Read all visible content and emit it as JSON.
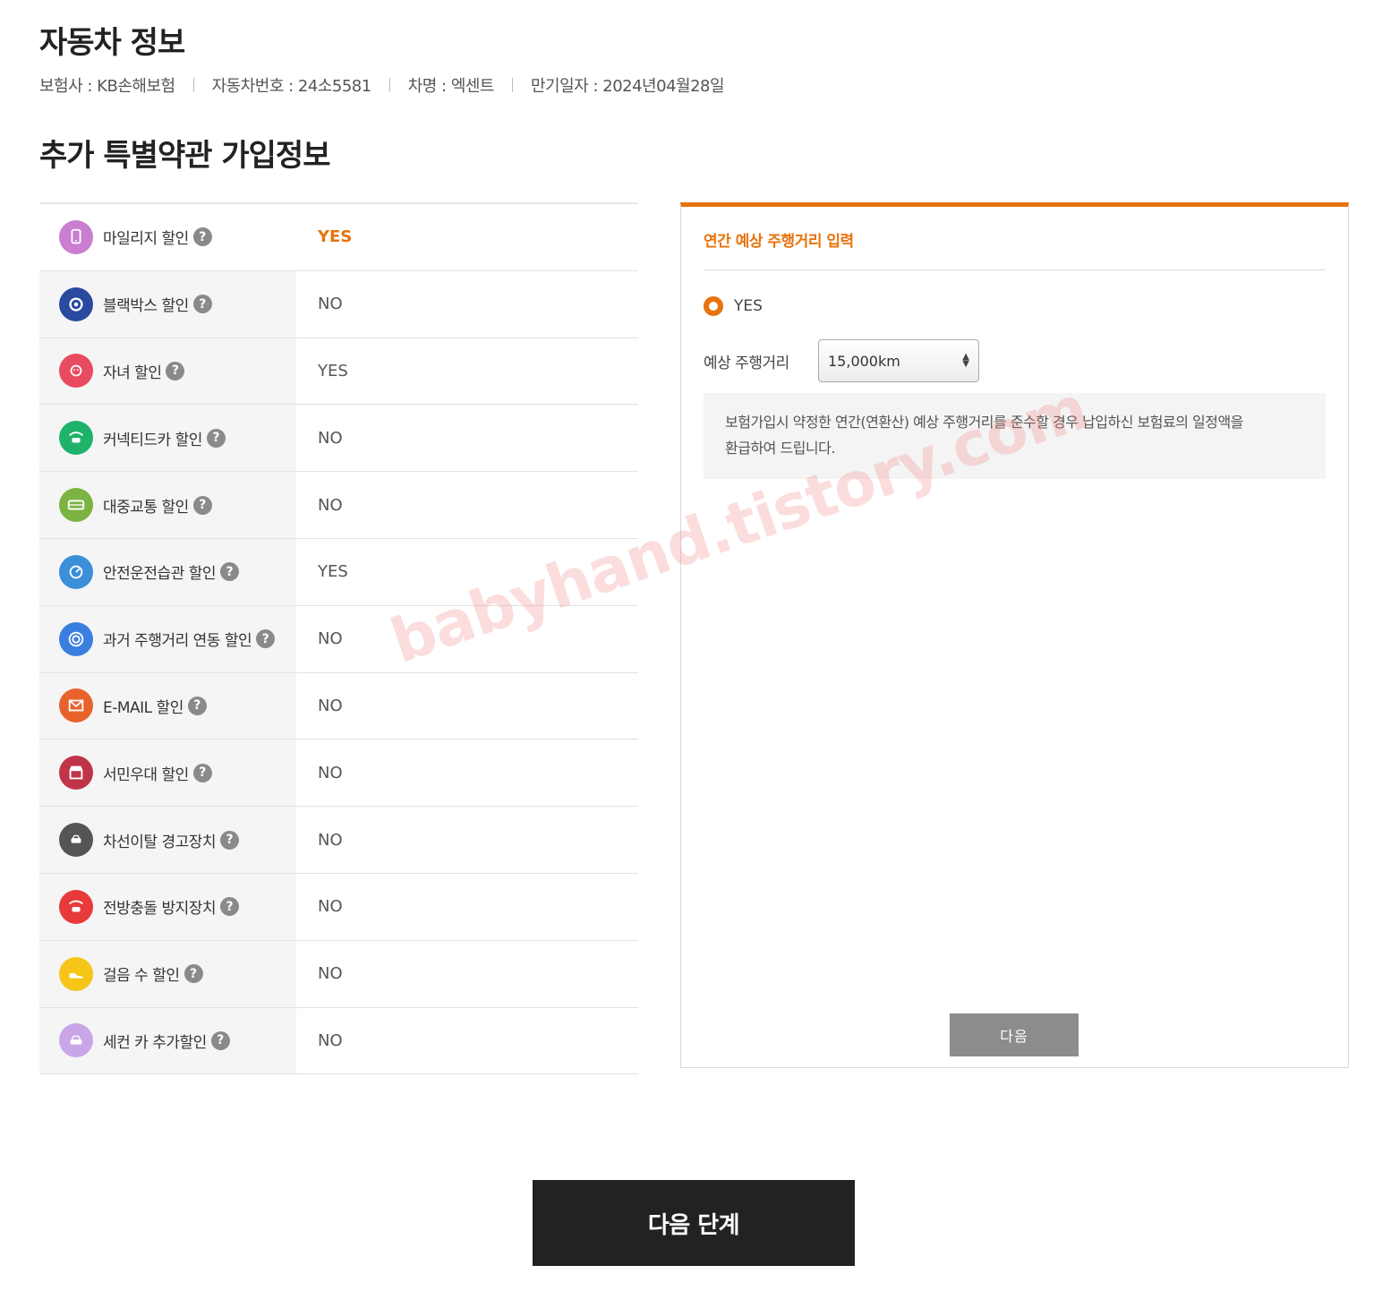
{
  "page": {
    "title": "자동차 정보",
    "section_title": "추가 특별약관 가입정보"
  },
  "car_info": {
    "insurer": "보험사 : KB손해보험",
    "car_number": "자동차번호 : 24소5581",
    "car_name": "차명 : 엑센트",
    "expiry": "만기일자 : 2024년04월28일"
  },
  "discounts": [
    {
      "label": "마일리지 할인",
      "value": "YES",
      "icon": "mileage-phone-icon",
      "color": "#c97ed0",
      "active": true
    },
    {
      "label": "블랙박스 할인",
      "value": "NO",
      "icon": "blackbox-camera-icon",
      "color": "#2a4aa0"
    },
    {
      "label": "자녀 할인",
      "value": "YES",
      "icon": "child-face-icon",
      "color": "#e84a5f"
    },
    {
      "label": "커넥티드카 할인",
      "value": "NO",
      "icon": "connected-car-icon",
      "color": "#1fb26b"
    },
    {
      "label": "대중교통 할인",
      "value": "NO",
      "icon": "bus-icon",
      "color": "#7cb342"
    },
    {
      "label": "안전운전습관 할인",
      "value": "YES",
      "icon": "speedometer-icon",
      "color": "#3a8fd8"
    },
    {
      "label": "과거 주행거리 연동 할인",
      "value": "NO",
      "icon": "target-icon",
      "color": "#3a7fe0"
    },
    {
      "label": "E-MAIL 할인",
      "value": "NO",
      "icon": "email-icon",
      "color": "#e8632c"
    },
    {
      "label": "서민우대 할인",
      "value": "NO",
      "icon": "shop-icon",
      "color": "#c0344a"
    },
    {
      "label": "차선이탈 경고장치",
      "value": "NO",
      "icon": "lane-car-icon",
      "color": "#555555"
    },
    {
      "label": "전방충돌 방지장치",
      "value": "NO",
      "icon": "collision-car-icon",
      "color": "#e83a3a"
    },
    {
      "label": "걸음 수 할인",
      "value": "NO",
      "icon": "shoe-icon",
      "color": "#f5c518"
    },
    {
      "label": "세컨 카 추가할인",
      "value": "NO",
      "icon": "second-car-icon",
      "color": "#c9a6e8"
    }
  ],
  "help_symbol": "?",
  "panel": {
    "title": "연간 예상 주행거리 입력",
    "radio_label": "YES",
    "distance_label": "예상 주행거리",
    "distance_value": "15,000km",
    "notice_line1": "보험가입시 약정한 연간(연환산) 예상 주행거리를 준수할 경우 납입하신 보험료의 일정액을",
    "notice_line2": "환급하여 드립니다.",
    "next_label": "다음"
  },
  "watermark": "babyhand.tistory.com",
  "footer": {
    "next_step_label": "다음 단계"
  }
}
